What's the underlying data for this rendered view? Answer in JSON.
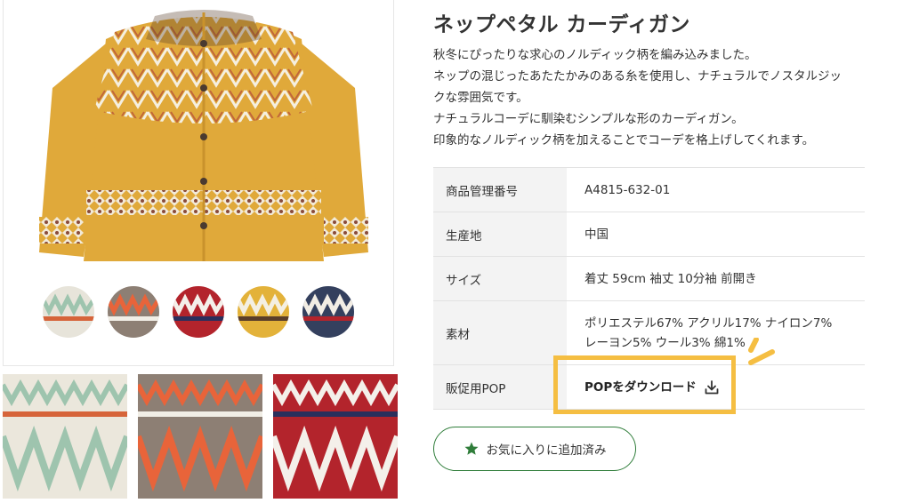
{
  "product": {
    "title": "ネップペタル カーディガン",
    "description": [
      "秋冬にぴったりな求心のノルディック柄を編み込みました。",
      "ネップの混じったあたたかみのある糸を使用し、ナチュラルでノスタルジッ",
      "クな雰囲気です。",
      "ナチュラルコーデに馴染むシンプルな形のカーディガン。",
      "印象的なノルディック柄を加えることでコーデを格上げしてくれます。"
    ]
  },
  "gallery": {
    "swatches": [
      {
        "icon": "swatch-mint",
        "colors": [
          "#e7e4da",
          "#9ec4ae",
          "#d6643a"
        ]
      },
      {
        "icon": "swatch-orange",
        "colors": [
          "#8d7f74",
          "#e8643a",
          "#f1eee6"
        ]
      },
      {
        "icon": "swatch-red",
        "colors": [
          "#b3242c",
          "#f4f0ea",
          "#2b2f5c"
        ]
      },
      {
        "icon": "swatch-mustard",
        "colors": [
          "#e3b23a",
          "#f4efe2",
          "#5a3e2a"
        ]
      },
      {
        "icon": "swatch-navy",
        "colors": [
          "#34405e",
          "#f2ede4",
          "#b3242c"
        ]
      }
    ]
  },
  "spec": {
    "rows": [
      {
        "key": "商品管理番号",
        "lines": [
          "A4815-632-01"
        ]
      },
      {
        "key": "生産地",
        "lines": [
          "中国"
        ]
      },
      {
        "key": "サイズ",
        "lines": [
          "着丈 59cm 袖丈 10分袖 前開き"
        ]
      },
      {
        "key": "素材",
        "lines": [
          "ポリエステル67% アクリル17% ナイロン7%",
          "レーヨン5% ウール3% 綿1%"
        ]
      },
      {
        "key": "販促用POP",
        "link": "POPをダウンロード"
      }
    ]
  },
  "favorite": {
    "label": "お気に入りに追加済み"
  },
  "colors": {
    "accent_green": "#2f7d3a",
    "highlight_yellow": "#f5be42",
    "mustard": "#e0a93a"
  }
}
